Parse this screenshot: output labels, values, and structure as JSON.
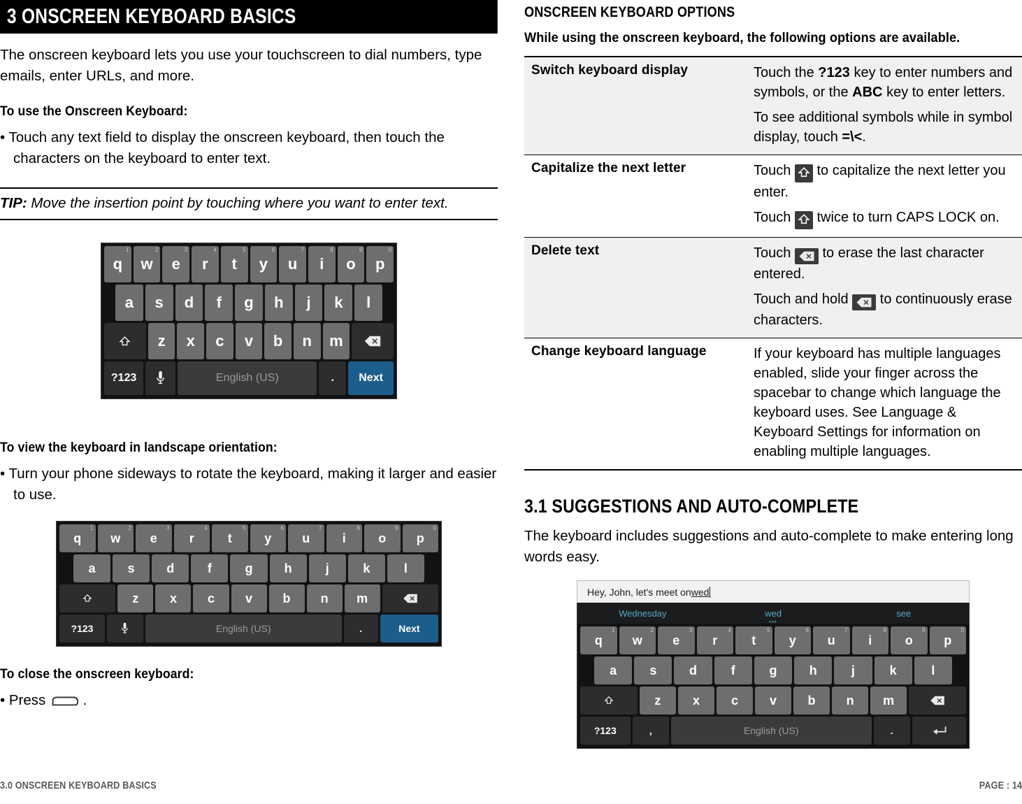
{
  "chapter": {
    "title": "3 ONSCREEN KEYBOARD BASICS",
    "intro": "The onscreen keyboard lets you use your touchscreen to dial numbers, type emails, enter URLs, and more."
  },
  "left": {
    "use_heading": "To use the Onscreen Keyboard:",
    "use_bullet": "• Touch any text field to display the onscreen keyboard, then touch the characters on the keyboard to enter text.",
    "tip_label": "TIP:",
    "tip_text": "Move the insertion point by touching where you want to enter text.",
    "landscape_heading": "To view the keyboard in landscape orientation:",
    "landscape_bullet": "• Turn your phone sideways to rotate the keyboard, making it larger and easier to use.",
    "close_heading": "To close the onscreen keyboard:",
    "close_bullet_pre": "• Press",
    "close_bullet_post": "."
  },
  "right": {
    "options_heading": "ONSCREEN KEYBOARD OPTIONS",
    "options_subheading": "While using the onscreen keyboard, the following options are available.",
    "table": [
      {
        "shaded": true,
        "label": "Switch keyboard display",
        "paragraphs": [
          {
            "parts": [
              {
                "t": "Touch the ",
                "b": false
              },
              {
                "t": "?123",
                "b": true
              },
              {
                "t": " key to enter numbers and symbols, or the ",
                "b": false
              },
              {
                "t": "ABC",
                "b": true
              },
              {
                "t": " key to enter letters.",
                "b": false
              }
            ]
          },
          {
            "parts": [
              {
                "t": "To see additional symbols while in symbol display, touch ",
                "b": false
              },
              {
                "t": "=\\<",
                "b": true
              },
              {
                "t": ".",
                "b": false
              }
            ]
          }
        ]
      },
      {
        "shaded": false,
        "label": "Capitalize the next letter",
        "paragraphs": [
          {
            "icon": "shift-key-icon",
            "pre": "Touch ",
            "post": " to capitalize the next letter you enter."
          },
          {
            "icon": "shift-key-icon",
            "pre": "Touch ",
            "post": " twice to turn CAPS LOCK on."
          }
        ]
      },
      {
        "shaded": true,
        "label": "Delete text",
        "paragraphs": [
          {
            "icon": "delete-key-icon",
            "pre": "Touch ",
            "post": " to erase the last character entered."
          },
          {
            "icon": "delete-key-icon",
            "pre": "Touch and hold ",
            "post": " to continuously erase characters."
          }
        ]
      },
      {
        "shaded": false,
        "label": "Change keyboard language",
        "paragraphs": [
          {
            "parts": [
              {
                "t": "If your keyboard has multiple languages enabled, slide your finger across the spacebar to change which language the keyboard uses. See Language & Keyboard Settings for information on enabling multiple languages.",
                "b": false
              }
            ]
          }
        ]
      }
    ],
    "section_31_title": "3.1 SUGGESTIONS AND AUTO-COMPLETE",
    "section_31_body": "The keyboard includes suggestions and auto-complete to make entering long words easy."
  },
  "keyboard": {
    "row1": [
      "q",
      "w",
      "e",
      "r",
      "t",
      "y",
      "u",
      "i",
      "o",
      "p"
    ],
    "row1_nums": [
      "1",
      "2",
      "3",
      "4",
      "5",
      "6",
      "7",
      "8",
      "9",
      "0"
    ],
    "row2": [
      "a",
      "s",
      "d",
      "f",
      "g",
      "h",
      "j",
      "k",
      "l"
    ],
    "row3": [
      "z",
      "x",
      "c",
      "v",
      "b",
      "n",
      "m"
    ],
    "symbols_key": "?123",
    "space_label": "English (US)",
    "period_key": ".",
    "comma_key": ",",
    "action_key": "Next"
  },
  "suggestions_demo": {
    "field_prefix": "Hey, John, let's meet on ",
    "field_typed": "wed",
    "suggestions": [
      "Wednesday",
      "wed",
      "see"
    ],
    "active_dots": "•••"
  },
  "footer": {
    "left": "3.0 ONSCREEN KEYBOARD BASICS",
    "right": "PAGE : 14"
  }
}
